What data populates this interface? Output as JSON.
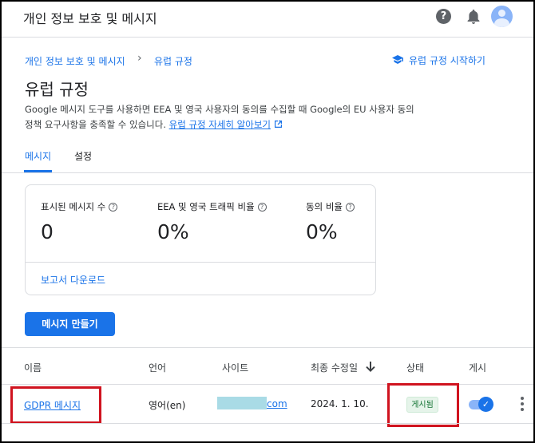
{
  "app": {
    "title": "개인 정보 보호 및 메시지"
  },
  "icons": {
    "help": "help-icon",
    "bell": "bell-icon",
    "avatar": "account-avatar",
    "school": "school-icon",
    "external": "open-in-new-icon",
    "sort": "arrow-down-icon",
    "more": "more-vert-icon"
  },
  "breadcrumb": {
    "parent": "개인 정보 보호 및 메시지",
    "separator": "›",
    "current": "유럽 규정"
  },
  "start_link": "유럽 규정 시작하기",
  "page": {
    "title": "유럽 규정",
    "description_line1": "Google 메시지 도구를 사용하면 EEA 및 영국 사용자의 동의를 수집할 때 Google의 EU 사용자 동의",
    "description_line2": "정책 요구사항을 충족할 수 있습니다.",
    "description_link": "유럽 규정 자세히 알아보기"
  },
  "tabs": [
    {
      "label": "메시지",
      "active": true
    },
    {
      "label": "설정",
      "active": false
    }
  ],
  "stats": [
    {
      "label": "표시된 메시지 수",
      "value": "0"
    },
    {
      "label": "EEA 및 영국 트래픽 비율",
      "value": "0%"
    },
    {
      "label": "동의 비율",
      "value": "0%"
    }
  ],
  "download_label": "보고서 다운로드",
  "create_button": "메시지 만들기",
  "table": {
    "headers": {
      "name": "이름",
      "language": "언어",
      "site": "사이트",
      "modified": "최종 수정일",
      "status": "상태",
      "publish": "게시"
    },
    "rows": [
      {
        "name": "GDPR 메시지",
        "language": "영어(en)",
        "site_suffix": "com",
        "modified": "2024. 1. 10.",
        "status": "게시됨",
        "published": true
      }
    ]
  },
  "colors": {
    "accent": "#1a73e8",
    "highlight": "#d0131f",
    "status_green": "#137333"
  }
}
